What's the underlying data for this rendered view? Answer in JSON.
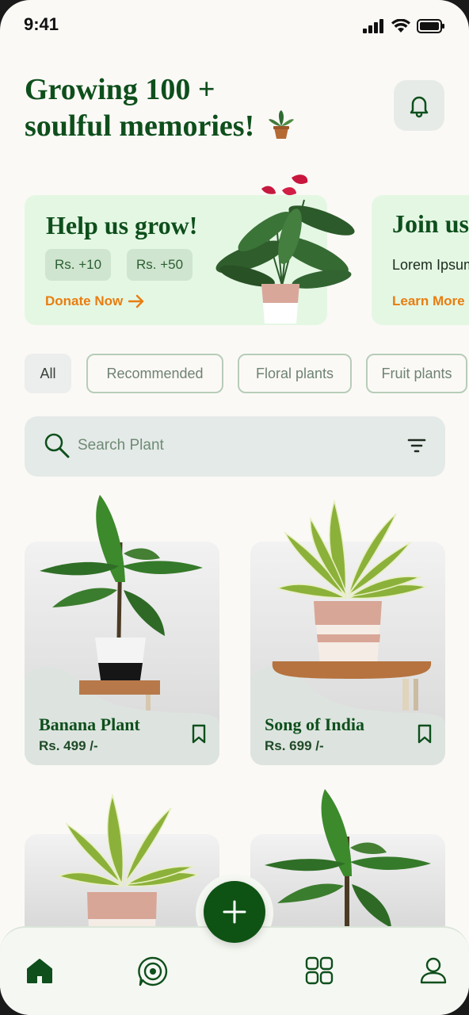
{
  "status_bar": {
    "time": "9:41"
  },
  "header": {
    "title_line1": "Growing 100 +",
    "title_line2": "soulful memories!",
    "bell_icon": "bell-icon"
  },
  "banners": [
    {
      "title": "Help us grow!",
      "amounts": [
        "Rs. +10",
        "Rs. +50"
      ],
      "action": "Donate Now"
    },
    {
      "title": "Join us",
      "text": "Lorem Ipsum",
      "action": "Learn More"
    }
  ],
  "filters": [
    "All",
    "Recommended",
    "Floral plants",
    "Fruit plants"
  ],
  "search": {
    "placeholder": "Search Plant"
  },
  "products": [
    {
      "name": "Banana Plant",
      "price": "Rs. 499 /-"
    },
    {
      "name": "Song of India",
      "price": "Rs. 699 /-"
    },
    {
      "name": "",
      "price": ""
    },
    {
      "name": "",
      "price": ""
    }
  ],
  "colors": {
    "primary": "#0e4f1c",
    "accent": "#e87d10",
    "banner_bg": "#e4f7e3",
    "background": "#fbf9f6"
  },
  "nav": [
    "home-icon",
    "explore-icon",
    "add-icon",
    "grid-icon",
    "profile-icon"
  ]
}
